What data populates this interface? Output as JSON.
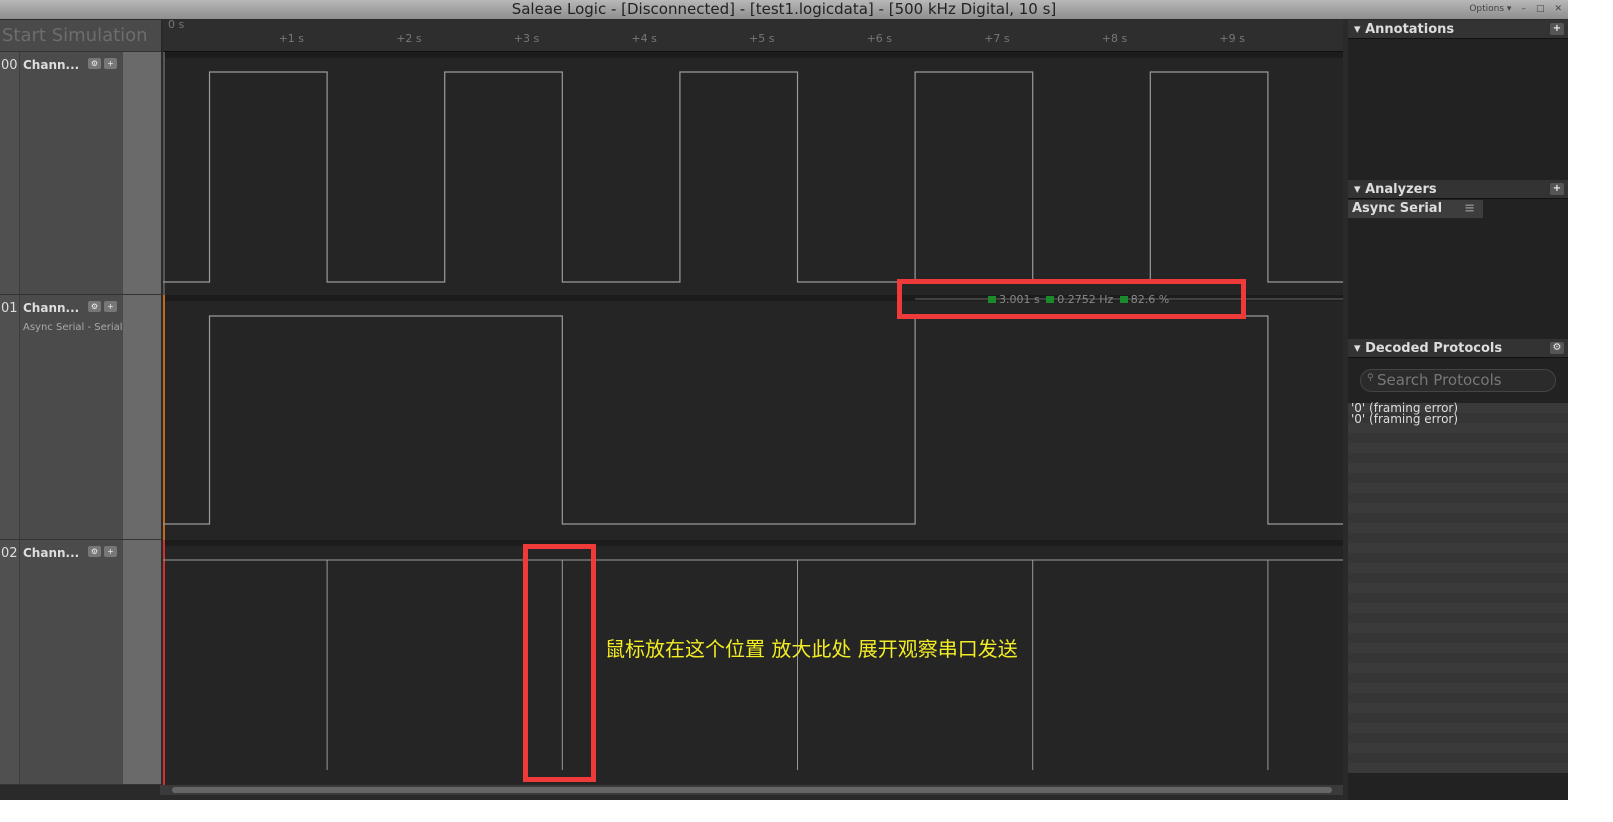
{
  "title": "Saleae Logic - [Disconnected] - [test1.logicdata] - [500 kHz Digital, 10 s]",
  "window": {
    "options": "Options ▾",
    "minimize": "–",
    "maximize": "□",
    "close": "✕"
  },
  "start_simulation": "Start Simulation",
  "ruler": {
    "origin": "0 s",
    "ticks": [
      "+1 s",
      "+2 s",
      "+3 s",
      "+4 s",
      "+5 s",
      "+6 s",
      "+7 s",
      "+8 s",
      "+9 s"
    ]
  },
  "channels": [
    {
      "num": "00",
      "name": "Chann...",
      "sub": "",
      "high_intervals_s": [
        [
          0.37,
          1.37
        ],
        [
          2.37,
          3.37
        ],
        [
          4.37,
          5.37
        ],
        [
          6.37,
          7.37
        ],
        [
          8.37,
          9.37
        ]
      ]
    },
    {
      "num": "01",
      "name": "Chann...",
      "sub": "Async Serial - Serial",
      "high_intervals_s": [
        [
          0.37,
          3.37
        ],
        [
          6.37,
          9.37
        ]
      ]
    },
    {
      "num": "02",
      "name": "Chann...",
      "sub": "",
      "pulses_s": [
        1.37,
        3.37,
        5.37,
        7.37,
        9.37
      ]
    }
  ],
  "channel_colors": [
    "#555555",
    "#c06a1a",
    "#d03030"
  ],
  "measurement": {
    "width": "3.001 s",
    "frequency": "0.2752 Hz",
    "duty": "82.6 %"
  },
  "annotation_note": "鼠标放在这个位置 放大此处 展开观察串口发送",
  "panels": {
    "annotations": "Annotations",
    "analyzers": "Analyzers",
    "analyzer_item": "Async Serial",
    "decoded": "Decoded Protocols",
    "search_placeholder": "Search Protocols",
    "results": [
      "'0' (framing error)",
      "'0' (framing error)"
    ]
  }
}
